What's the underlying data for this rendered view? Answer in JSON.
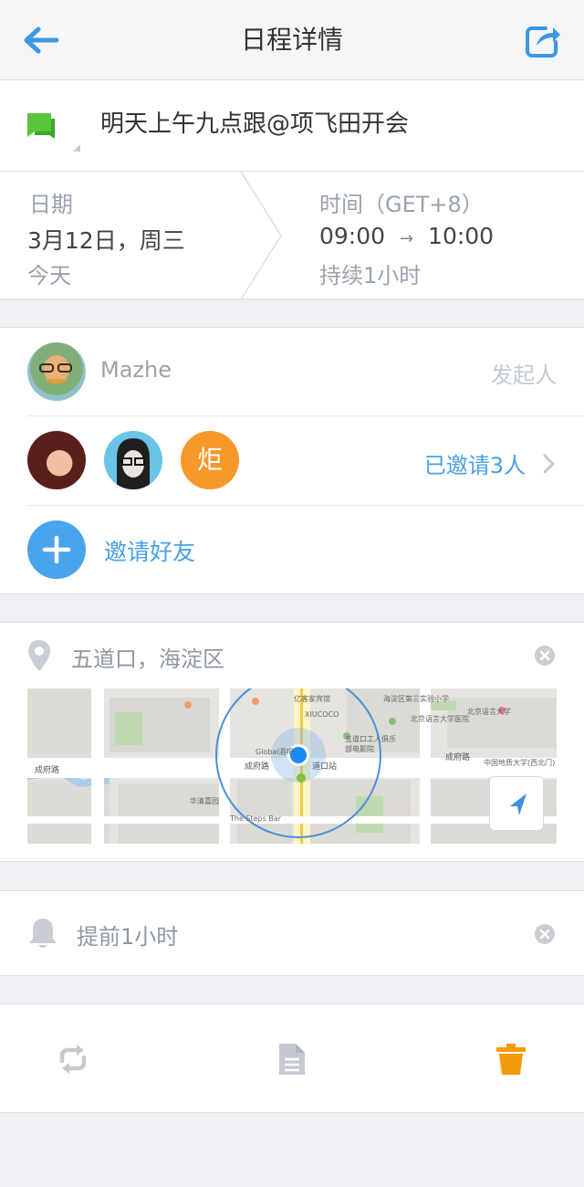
{
  "nav": {
    "title": "日程详情",
    "back_icon": "back-arrow-icon",
    "share_icon": "share-icon"
  },
  "event": {
    "title": "明天上午九点跟@项飞田开会",
    "flag_icon": "chat-flag-icon"
  },
  "date": {
    "label": "日期",
    "value": "3月12日，周三",
    "relative": "今天"
  },
  "time": {
    "label": "时间（GET+8）",
    "start": "09:00",
    "arrow": "→",
    "end": "10:00",
    "duration": "持续1小时"
  },
  "organizer": {
    "name": "Mazhe",
    "role": "发起人"
  },
  "invitees": {
    "avatar_char": "炬",
    "count_label": "已邀请3人"
  },
  "invite": {
    "label": "邀请好友",
    "icon": "plus-icon"
  },
  "location": {
    "label": "五道口，海淀区",
    "icon": "location-pin-icon",
    "map_labels": {
      "road_chengfu": "成府路",
      "road_chengfu_west": "成府路",
      "road_chengfu_east": "成府路",
      "station": "道口站",
      "global_bar": "Global酒吧",
      "xiucoco": "XIUCOCO",
      "yiyijia": "亿客家宾馆",
      "huoju": "海淀区第三实验小学",
      "steps_bar": "The Steps Bar",
      "huaqing": "华清嘉园",
      "wudaokou_mall": "五道口工人俱乐部电影院",
      "zhongguancun": "中国地质大学(西北门)",
      "hospital": "北京语言大学医院",
      "beijing_yuyan": "北京语言大学"
    },
    "colors": {
      "accent_circle": "#4a90d9",
      "pin": "#1a8cf0"
    }
  },
  "reminder": {
    "label": "提前1小时",
    "icon": "bell-icon"
  },
  "toolbar": {
    "repeat_icon": "repeat-icon",
    "note_icon": "document-icon",
    "delete_icon": "trash-icon"
  },
  "colors": {
    "accent": "#4aa0e6",
    "flag_green": "#5ac43a",
    "invitee_orange": "#f7982b",
    "trash_orange": "#f59a0c"
  }
}
